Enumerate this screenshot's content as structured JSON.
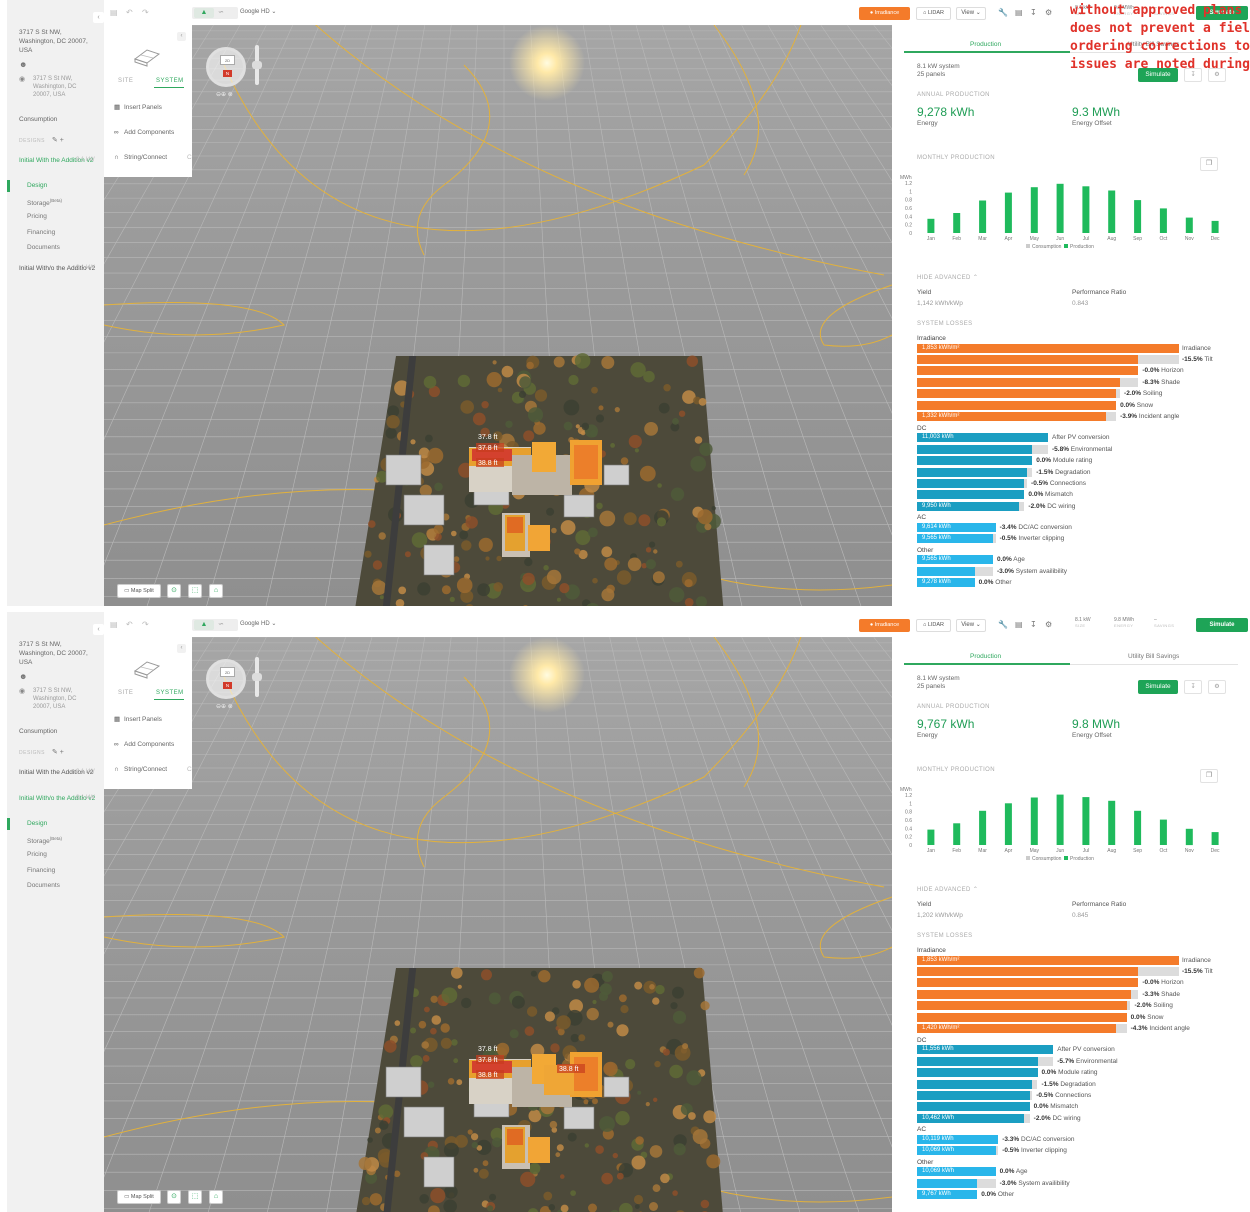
{
  "overlay_lines": [
    "without approved plans",
    "does not prevent a field",
    "ordering corrections to",
    "issues are noted during"
  ],
  "panes": [
    {
      "sidebar": {
        "address": "3717 S St NW, Washington, DC 20007, USA",
        "address_short": "3717 S St NW, Washington, DC 20007, USA",
        "consumption": "Consumption",
        "designs_label": "DESIGNS",
        "designs": [
          {
            "name": "Initial With the Addition v2",
            "kw": "8.1 kW",
            "active": true
          },
          {
            "name": "Initial With/o the Additio v2",
            "kw": "8.1 kW",
            "active": false
          }
        ],
        "subnav": [
          "Design",
          "Storage",
          "Pricing",
          "Financing",
          "Documents"
        ],
        "storage_sup": "(Beta)"
      },
      "toolbar": {
        "map_source": "Google HD",
        "irradiance": "Irradiance",
        "lidar": "LIDAR",
        "view": "View",
        "stats": [
          {
            "value": "8.1 kW",
            "label": "SIZE"
          },
          {
            "value": "9.3 MWh",
            "label": "ENERGY"
          },
          {
            "value": "–",
            "label": "SAVINGS"
          }
        ],
        "simulate": "Simulate"
      },
      "system_panel": {
        "tab_site": "SITE",
        "tab_system": "SYSTEM",
        "items": [
          "Insert Panels",
          "Add Components",
          "String/Connect"
        ],
        "string_key": "C"
      },
      "compass": {
        "top_label": "2D",
        "north": "N"
      },
      "measurements": [
        "37.8 ft",
        "37.8 ft",
        "38.8 ft"
      ],
      "map_split": "Map Split",
      "production": {
        "tab_production": "Production",
        "tab_savings": "Utility Bill Savings",
        "system_size": "8.1 kW system",
        "panels": "25 panels",
        "simulate": "Simulate",
        "annual_label": "ANNUAL PRODUCTION",
        "energy_value": "9,278 kWh",
        "energy_label": "Energy",
        "offset_value": "9.3 MWh",
        "offset_label": "Energy Offset",
        "monthly_label": "MONTHLY PRODUCTION",
        "advanced_label": "HIDE ADVANCED",
        "yield_label": "Yield",
        "yield_value": "1,142 kWh/kWp",
        "pr_label": "Performance Ratio",
        "pr_value": "0.843",
        "losses_label": "SYSTEM LOSSES"
      },
      "chart_data": {
        "type": "bar",
        "ylabel": "MWh",
        "ylim": [
          0,
          1.2
        ],
        "yticks": [
          0,
          0.2,
          0.4,
          0.6,
          0.8,
          1,
          1.2
        ],
        "categories": [
          "Jan",
          "Feb",
          "Mar",
          "Apr",
          "May",
          "Jun",
          "Jul",
          "Aug",
          "Sep",
          "Oct",
          "Nov",
          "Dec"
        ],
        "series": [
          {
            "name": "Consumption",
            "values": [
              0,
              0,
              0,
              0,
              0,
              0,
              0,
              0,
              0,
              0,
              0,
              0
            ]
          },
          {
            "name": "Production",
            "values": [
              0.34,
              0.48,
              0.78,
              0.97,
              1.1,
              1.18,
              1.12,
              1.02,
              0.79,
              0.59,
              0.37,
              0.29
            ]
          }
        ],
        "legend": "bottom"
      },
      "losses": {
        "groups": [
          {
            "label": "Irradiance",
            "rows": [
              {
                "bar": "1,853 kWh/m²",
                "pct": "",
                "name": "Irradiance",
                "frac": 1.0
              },
              {
                "bar": "",
                "pct": "-15.5%",
                "name": "Tilt",
                "frac": 0.845
              },
              {
                "bar": "",
                "pct": "-0.0%",
                "name": "Horizon",
                "frac": 0.845
              },
              {
                "bar": "",
                "pct": "-8.3%",
                "name": "Shade",
                "frac": 0.775
              },
              {
                "bar": "",
                "pct": "-2.0%",
                "name": "Soiling",
                "frac": 0.76
              },
              {
                "bar": "",
                "pct": "0.0%",
                "name": "Snow",
                "frac": 0.76
              },
              {
                "bar": "1,332 kWh/m²",
                "pct": "-3.9%",
                "name": "Incident angle",
                "frac": 0.72
              }
            ]
          },
          {
            "label": "DC",
            "rows": [
              {
                "bar": "11,003 kWh",
                "pct": "",
                "name": "After PV conversion",
                "frac": 0.5
              },
              {
                "bar": "",
                "pct": "-5.8%",
                "name": "Environmental",
                "frac": 0.44
              },
              {
                "bar": "",
                "pct": "0.0%",
                "name": "Module rating",
                "frac": 0.44
              },
              {
                "bar": "",
                "pct": "-1.5%",
                "name": "Degradation",
                "frac": 0.42
              },
              {
                "bar": "",
                "pct": "-0.5%",
                "name": "Connections",
                "frac": 0.41
              },
              {
                "bar": "",
                "pct": "0.0%",
                "name": "Mismatch",
                "frac": 0.41
              },
              {
                "bar": "9,950 kWh",
                "pct": "-2.0%",
                "name": "DC wiring",
                "frac": 0.39
              }
            ]
          },
          {
            "label": "AC",
            "rows": [
              {
                "bar": "9,614 kWh",
                "pct": "-3.4%",
                "name": "DC/AC conversion",
                "frac": 0.3
              },
              {
                "bar": "9,565 kWh",
                "pct": "-0.5%",
                "name": "Inverter clipping",
                "frac": 0.29
              }
            ]
          },
          {
            "label": "Other",
            "rows": [
              {
                "bar": "9,565 kWh",
                "pct": "0.0%",
                "name": "Age",
                "frac": 0.29
              },
              {
                "bar": "",
                "pct": "-3.0%",
                "name": "System availibility",
                "frac": 0.22
              },
              {
                "bar": "9,278 kWh",
                "pct": "0.0%",
                "name": "Other",
                "frac": 0.22
              }
            ]
          }
        ]
      }
    },
    {
      "sidebar": {
        "address": "3717 S St NW, Washington, DC 20007, USA",
        "address_short": "3717 S St NW, Washington, DC 20007, USA",
        "consumption": "Consumption",
        "designs_label": "DESIGNS",
        "designs": [
          {
            "name": "Initial With the Addition v2",
            "kw": "8.1 kW",
            "active": false
          },
          {
            "name": "Initial With/o the Additio v2",
            "kw": "8.1 kW",
            "active": true
          }
        ],
        "subnav": [
          "Design",
          "Storage",
          "Pricing",
          "Financing",
          "Documents"
        ],
        "storage_sup": "(Beta)"
      },
      "toolbar": {
        "map_source": "Google HD",
        "irradiance": "Irradiance",
        "lidar": "LIDAR",
        "view": "View",
        "stats": [
          {
            "value": "8.1 kW",
            "label": "SIZE"
          },
          {
            "value": "9.8 MWh",
            "label": "ENERGY"
          },
          {
            "value": "–",
            "label": "SAVINGS"
          }
        ],
        "simulate": "Simulate"
      },
      "system_panel": {
        "tab_site": "SITE",
        "tab_system": "SYSTEM",
        "items": [
          "Insert Panels",
          "Add Components",
          "String/Connect"
        ],
        "string_key": "C"
      },
      "compass": {
        "top_label": "2D",
        "north": "N"
      },
      "measurements": [
        "37.8 ft",
        "37.8 ft",
        "38.8 ft",
        "38.8 ft"
      ],
      "map_split": "Map Split",
      "production": {
        "tab_production": "Production",
        "tab_savings": "Utility Bill Savings",
        "system_size": "8.1 kW system",
        "panels": "25 panels",
        "simulate": "Simulate",
        "annual_label": "ANNUAL PRODUCTION",
        "energy_value": "9,767 kWh",
        "energy_label": "Energy",
        "offset_value": "9.8 MWh",
        "offset_label": "Energy Offset",
        "monthly_label": "MONTHLY PRODUCTION",
        "advanced_label": "HIDE ADVANCED",
        "yield_label": "Yield",
        "yield_value": "1,202 kWh/kWp",
        "pr_label": "Performance Ratio",
        "pr_value": "0.845",
        "losses_label": "SYSTEM LOSSES"
      },
      "chart_data": {
        "type": "bar",
        "ylabel": "MWh",
        "ylim": [
          0,
          1.2
        ],
        "yticks": [
          0,
          0.2,
          0.4,
          0.6,
          0.8,
          1,
          1.2
        ],
        "categories": [
          "Jan",
          "Feb",
          "Mar",
          "Apr",
          "May",
          "Jun",
          "Jul",
          "Aug",
          "Sep",
          "Oct",
          "Nov",
          "Dec"
        ],
        "series": [
          {
            "name": "Consumption",
            "values": [
              0,
              0,
              0,
              0,
              0,
              0,
              0,
              0,
              0,
              0,
              0,
              0
            ]
          },
          {
            "name": "Production",
            "values": [
              0.37,
              0.52,
              0.82,
              1.0,
              1.14,
              1.21,
              1.15,
              1.06,
              0.82,
              0.61,
              0.39,
              0.31
            ]
          }
        ],
        "legend": "bottom"
      },
      "losses": {
        "groups": [
          {
            "label": "Irradiance",
            "rows": [
              {
                "bar": "1,853 kWh/m²",
                "pct": "",
                "name": "Irradiance",
                "frac": 1.0
              },
              {
                "bar": "",
                "pct": "-15.5%",
                "name": "Tilt",
                "frac": 0.845
              },
              {
                "bar": "",
                "pct": "-0.0%",
                "name": "Horizon",
                "frac": 0.845
              },
              {
                "bar": "",
                "pct": "-3.3%",
                "name": "Shade",
                "frac": 0.815
              },
              {
                "bar": "",
                "pct": "-2.0%",
                "name": "Soiling",
                "frac": 0.8
              },
              {
                "bar": "",
                "pct": "0.0%",
                "name": "Snow",
                "frac": 0.8
              },
              {
                "bar": "1,420 kWh/m²",
                "pct": "-4.3%",
                "name": "Incident angle",
                "frac": 0.76
              }
            ]
          },
          {
            "label": "DC",
            "rows": [
              {
                "bar": "11,556 kWh",
                "pct": "",
                "name": "After PV conversion",
                "frac": 0.52
              },
              {
                "bar": "",
                "pct": "-5.7%",
                "name": "Environmental",
                "frac": 0.46
              },
              {
                "bar": "",
                "pct": "0.0%",
                "name": "Module rating",
                "frac": 0.46
              },
              {
                "bar": "",
                "pct": "-1.5%",
                "name": "Degradation",
                "frac": 0.44
              },
              {
                "bar": "",
                "pct": "-0.5%",
                "name": "Connections",
                "frac": 0.43
              },
              {
                "bar": "",
                "pct": "0.0%",
                "name": "Mismatch",
                "frac": 0.43
              },
              {
                "bar": "10,462 kWh",
                "pct": "-2.0%",
                "name": "DC wiring",
                "frac": 0.41
              }
            ]
          },
          {
            "label": "AC",
            "rows": [
              {
                "bar": "10,119 kWh",
                "pct": "-3.3%",
                "name": "DC/AC conversion",
                "frac": 0.31
              },
              {
                "bar": "10,069 kWh",
                "pct": "-0.5%",
                "name": "Inverter clipping",
                "frac": 0.3
              }
            ]
          },
          {
            "label": "Other",
            "rows": [
              {
                "bar": "10,069 kWh",
                "pct": "0.0%",
                "name": "Age",
                "frac": 0.3
              },
              {
                "bar": "",
                "pct": "-3.0%",
                "name": "System availibility",
                "frac": 0.23
              },
              {
                "bar": "9,767 kWh",
                "pct": "0.0%",
                "name": "Other",
                "frac": 0.23
              }
            ]
          }
        ]
      }
    }
  ],
  "colors": {
    "accent": "#1ea457",
    "irradiance": "#f47b2a",
    "dc": "#1b9ec2",
    "ac": "#29b6ea",
    "production_bar": "#1fba5c"
  }
}
